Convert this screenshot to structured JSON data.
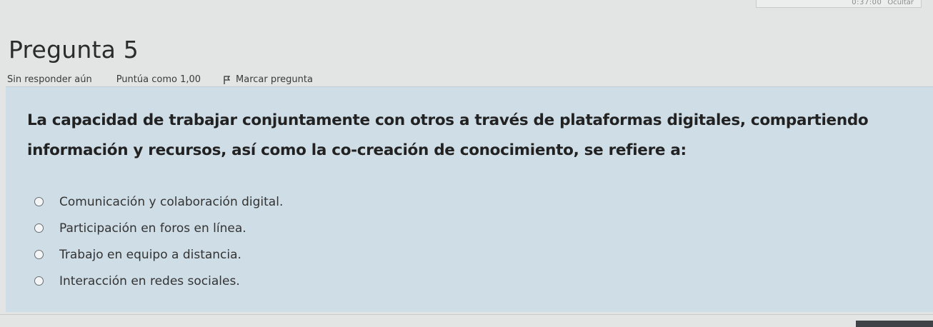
{
  "timer": {
    "time_left": "0:37:00",
    "hide_label": "Ocultar"
  },
  "question": {
    "title": "Pregunta 5",
    "status": "Sin responder aún",
    "grade": "Puntúa como 1,00",
    "flag_label": "Marcar pregunta",
    "text": "La capacidad de trabajar conjuntamente con otros a través de plataformas digitales, compartiendo información y recursos, así como la co-creación de conocimiento, se refiere a:",
    "options": [
      {
        "label": "Comunicación y colaboración digital.",
        "selected": false
      },
      {
        "label": "Participación en foros en línea.",
        "selected": false
      },
      {
        "label": "Trabajo en equipo a distancia.",
        "selected": false
      },
      {
        "label": "Interacción en redes sociales.",
        "selected": false
      }
    ]
  },
  "colors": {
    "panel": "#cfdde6",
    "background": "#e3e5e4",
    "text": "#2c2c2c"
  }
}
